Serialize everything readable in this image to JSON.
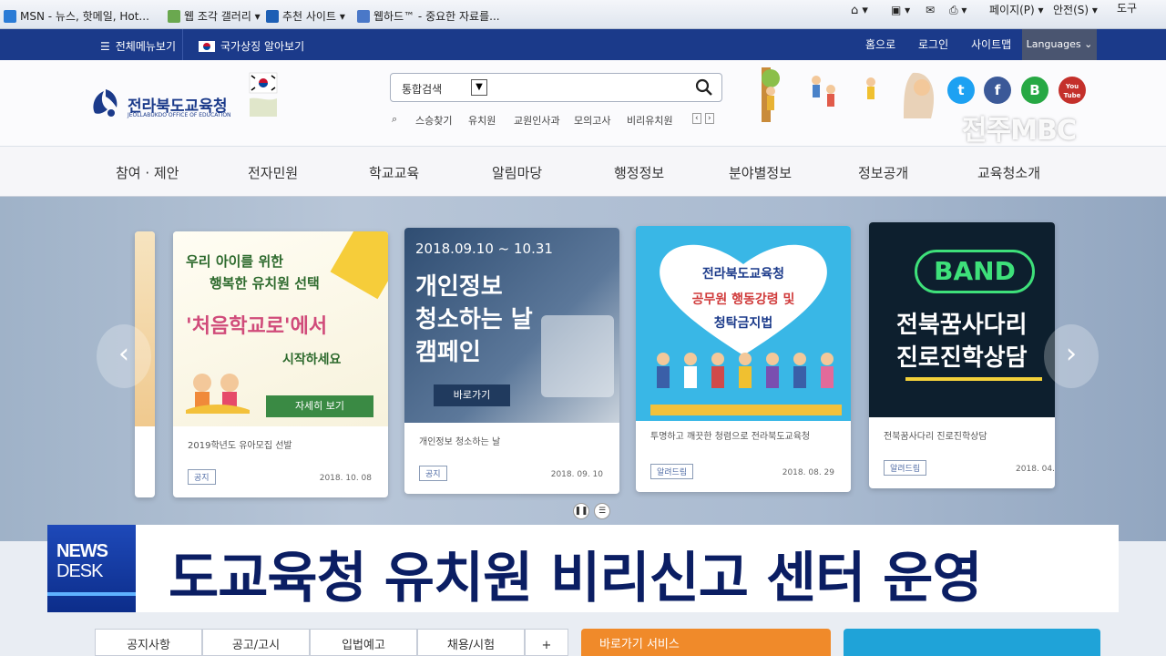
{
  "browser": {
    "favorites": [
      {
        "label": "MSN - 뉴스, 핫메일, Hot..."
      },
      {
        "label": "웹 조각 갤러리 ▾"
      },
      {
        "label": "추천 사이트 ▾"
      },
      {
        "label": "웹하드™ - 중요한 자료를..."
      }
    ],
    "commands": {
      "page": "페이지(P) ▾",
      "safety": "안전(S) ▾",
      "tools": "도구"
    }
  },
  "topbar": {
    "all_menu": "전체메뉴보기",
    "symbols": "국가상징 알아보기",
    "home": "홈으로",
    "login": "로그인",
    "sitemap": "사이트맵",
    "languages": "Languages"
  },
  "header": {
    "logo_name": "전라북도교육청",
    "logo_sub": "JEOLLABUKDO OFFICE OF EDUCATION",
    "search_scope": "통합검색",
    "quick_links": [
      "스승찾기",
      "유치원",
      "교원인사과",
      "모의고사",
      "비리유치원"
    ],
    "social": [
      {
        "name": "twitter",
        "glyph": "t",
        "color": "#1da1f2"
      },
      {
        "name": "facebook",
        "glyph": "f",
        "color": "#3b5998"
      },
      {
        "name": "band",
        "glyph": "B",
        "color": "#27a844"
      },
      {
        "name": "youtube",
        "glyph": "You Tube",
        "color": "#c4302b"
      }
    ],
    "watermark": "전주MBC"
  },
  "nav": {
    "items": [
      "참여 · 제안",
      "전자민원",
      "학교교육",
      "알림마당",
      "행정정보",
      "분야별정보",
      "정보공개",
      "교육청소개"
    ]
  },
  "cards": [
    {
      "poster_lines": [
        "우리 아이를 위한",
        "행복한 유치원 선택",
        "'처음학교로'에서",
        "시작하세요"
      ],
      "button": "자세히 보기",
      "caption": "2019학년도 유아모집 선발",
      "tag": "공지",
      "date": "2018. 10. 08"
    },
    {
      "poster_date": "2018.09.10 ~ 10.31",
      "poster_lines": [
        "개인정보",
        "청소하는 날",
        "캠페인"
      ],
      "button": "바로가기",
      "caption": "개인정보 청소하는 날",
      "tag": "공지",
      "date": "2018. 09. 10"
    },
    {
      "poster_lines": [
        "전라북도교육청",
        "공무원 행동강령 및",
        "청탁금지법"
      ],
      "caption": "투명하고 깨끗한 청렴으로 전라북도교육청",
      "tag": "알려드림",
      "date": "2018. 08. 29"
    },
    {
      "poster_badge": "BAND",
      "poster_lines": [
        "전북꿈사다리",
        "진로진학상담"
      ],
      "caption": "전북꿈사다리 진로진학상담",
      "tag": "알려드림",
      "date": "2018. 04."
    }
  ],
  "lower_tabs": [
    "공지사항",
    "공고/고시",
    "입법예고",
    "채용/시험",
    "+"
  ],
  "promo": {
    "label": "바로가기 서비스"
  },
  "news": {
    "brand_line1": "NEWS",
    "brand_line2": "DESK",
    "headline": "도교육청 유치원 비리신고 센터 운영"
  }
}
